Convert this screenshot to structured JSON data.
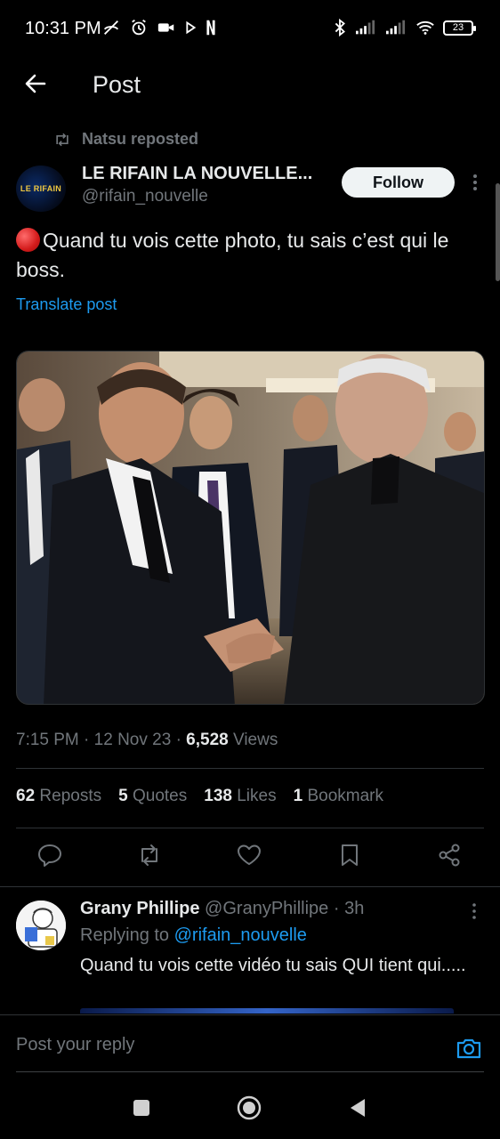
{
  "status_bar": {
    "time": "10:31 PM",
    "left_icons": [
      "wifi-off-calling-icon",
      "alarm-icon",
      "video-icon",
      "play-store-icon",
      "netflix-icon"
    ],
    "right_icons": [
      "bluetooth-icon",
      "signal-icon",
      "signal-icon",
      "wifi-icon",
      "battery-icon"
    ],
    "battery_level": "23"
  },
  "header": {
    "title": "Post",
    "back_icon": "arrow-left-icon"
  },
  "post": {
    "repost_label": "Natsu reposted",
    "author": {
      "display_name": "LE RIFAIN LA NOUVELLE...",
      "handle": "@rifain_nouvelle",
      "logo_text": "LE RIFAIN"
    },
    "follow_label": "Follow",
    "text": "Quand tu vois cette photo, tu sais c’est qui le boss.",
    "translate_label": "Translate post",
    "meta": {
      "time": "7:15 PM",
      "date": "12 Nov 23",
      "views_count": "6,528",
      "views_label": "Views"
    },
    "stats": {
      "reposts_count": "62",
      "reposts_label": "Reposts",
      "quotes_count": "5",
      "quotes_label": "Quotes",
      "likes_count": "138",
      "likes_label": "Likes",
      "bookmarks_count": "1",
      "bookmarks_label": "Bookmark"
    },
    "actions": [
      "reply-icon",
      "repost-icon",
      "like-icon",
      "bookmark-icon",
      "share-icon"
    ]
  },
  "reply": {
    "display_name": "Grany Phillipe",
    "handle": "@GranyPhillipe",
    "age": "3h",
    "replying_prefix": "Replying to",
    "replying_handle": "@rifain_nouvelle",
    "text": "Quand tu vois cette vidéo tu sais QUI tient qui....."
  },
  "reply_bar": {
    "placeholder": "Post your reply",
    "camera_icon": "camera-icon"
  },
  "nav_bar": [
    "recents-square-icon",
    "home-circle-icon",
    "back-triangle-icon"
  ],
  "colors": {
    "background": "#000000",
    "text": "#e7e9ea",
    "muted": "#71767b",
    "accent": "#1d9bf0",
    "divider": "#2f3336"
  }
}
